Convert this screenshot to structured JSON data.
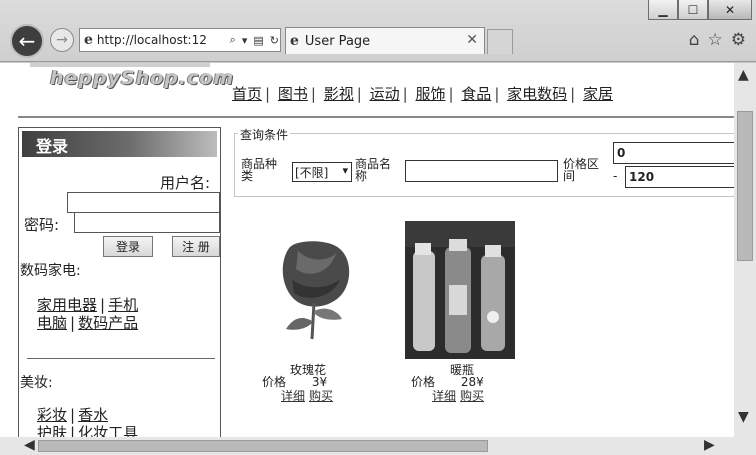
{
  "browser": {
    "address": "http://localhost:12",
    "tab_title": "User Page",
    "window_buttons": {
      "minimize": "▁",
      "maximize": "☐",
      "close": "✕"
    },
    "icons": [
      "back-arrow-icon",
      "forward-arrow-icon",
      "ie-icon",
      "search-icon",
      "refresh-icon",
      "home-icon",
      "star-icon",
      "gear-icon"
    ]
  },
  "header": {
    "logo_text": "heppyShop.com",
    "nav": [
      "首页",
      "图书",
      "影视",
      "运动",
      "服饰",
      "食品",
      "家电数码",
      "家居"
    ]
  },
  "login": {
    "title": "登录",
    "username_label": "用户名:",
    "password_label": "密码:",
    "login_button": "登录",
    "register_button": "注 册"
  },
  "categories": [
    {
      "title": "数码家电:",
      "row1": [
        "家用电器",
        "手机"
      ],
      "row2": [
        "电脑",
        "数码产品"
      ]
    },
    {
      "title": "美妆:",
      "row1": [
        "彩妆",
        "香水"
      ],
      "row2": [
        "护肤",
        "化妆工具"
      ]
    }
  ],
  "query": {
    "legend": "查询条件",
    "type_label_1": "商品种",
    "type_label_2": "类",
    "type_selected": "[不限]",
    "name_label_1": "商品名",
    "name_label_2": "称",
    "name_value": "",
    "price_label_1": "价格区",
    "price_label_2": "间",
    "price_min": "0",
    "price_dash": "-",
    "price_max": "120"
  },
  "products": [
    {
      "name": "玫瑰花",
      "price_label": "价格",
      "price": "3¥",
      "detail": "详细",
      "buy": "购买"
    },
    {
      "name": "暖瓶",
      "price_label": "价格",
      "price": "28¥",
      "detail": "详细",
      "buy": "购买"
    }
  ]
}
